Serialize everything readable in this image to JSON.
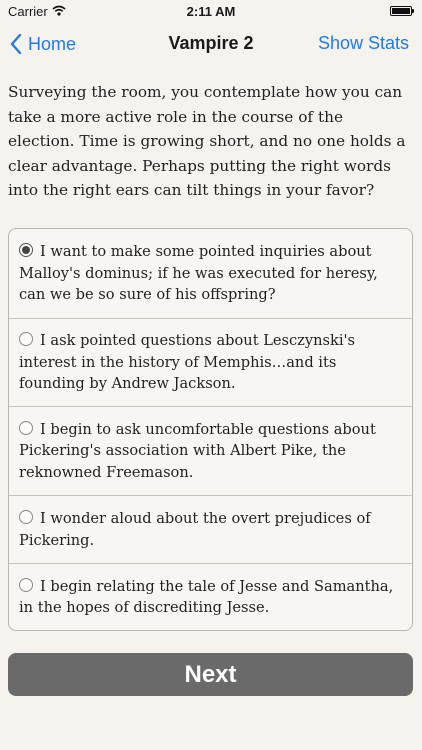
{
  "status_bar": {
    "carrier": "Carrier",
    "time": "2:11 AM",
    "icons": [
      "wifi-icon",
      "battery-icon"
    ]
  },
  "nav": {
    "back_label": "Home",
    "back_icon": "chevron-left-icon",
    "title": "Vampire 2",
    "right_label": "Show Stats"
  },
  "passage": "Surveying the room, you contemplate how you can take a more active role in the course of the election. Time is growing short, and no one holds a clear advantage. Perhaps putting the right words into the right ears can tilt things in your favor?",
  "choices": [
    {
      "text": "I want to make some pointed inquiries about Malloy's dominus; if he was executed for heresy, can we be so sure of his offspring?",
      "selected": true
    },
    {
      "text": "I ask pointed questions about Lesczynski's interest in the history of Memphis…and its founding by Andrew Jackson.",
      "selected": false
    },
    {
      "text": "I begin to ask uncomfortable questions about Pickering's association with Albert Pike, the reknowned Freemason.",
      "selected": false
    },
    {
      "text": "I wonder aloud about the overt prejudices of Pickering.",
      "selected": false
    },
    {
      "text": "I begin relating the tale of Jesse and Samantha, in the hopes of discrediting Jesse.",
      "selected": false
    }
  ],
  "next_label": "Next",
  "colors": {
    "accent": "#1f7be6",
    "button": "#6a6a6a",
    "background": "#f6f3ef"
  }
}
